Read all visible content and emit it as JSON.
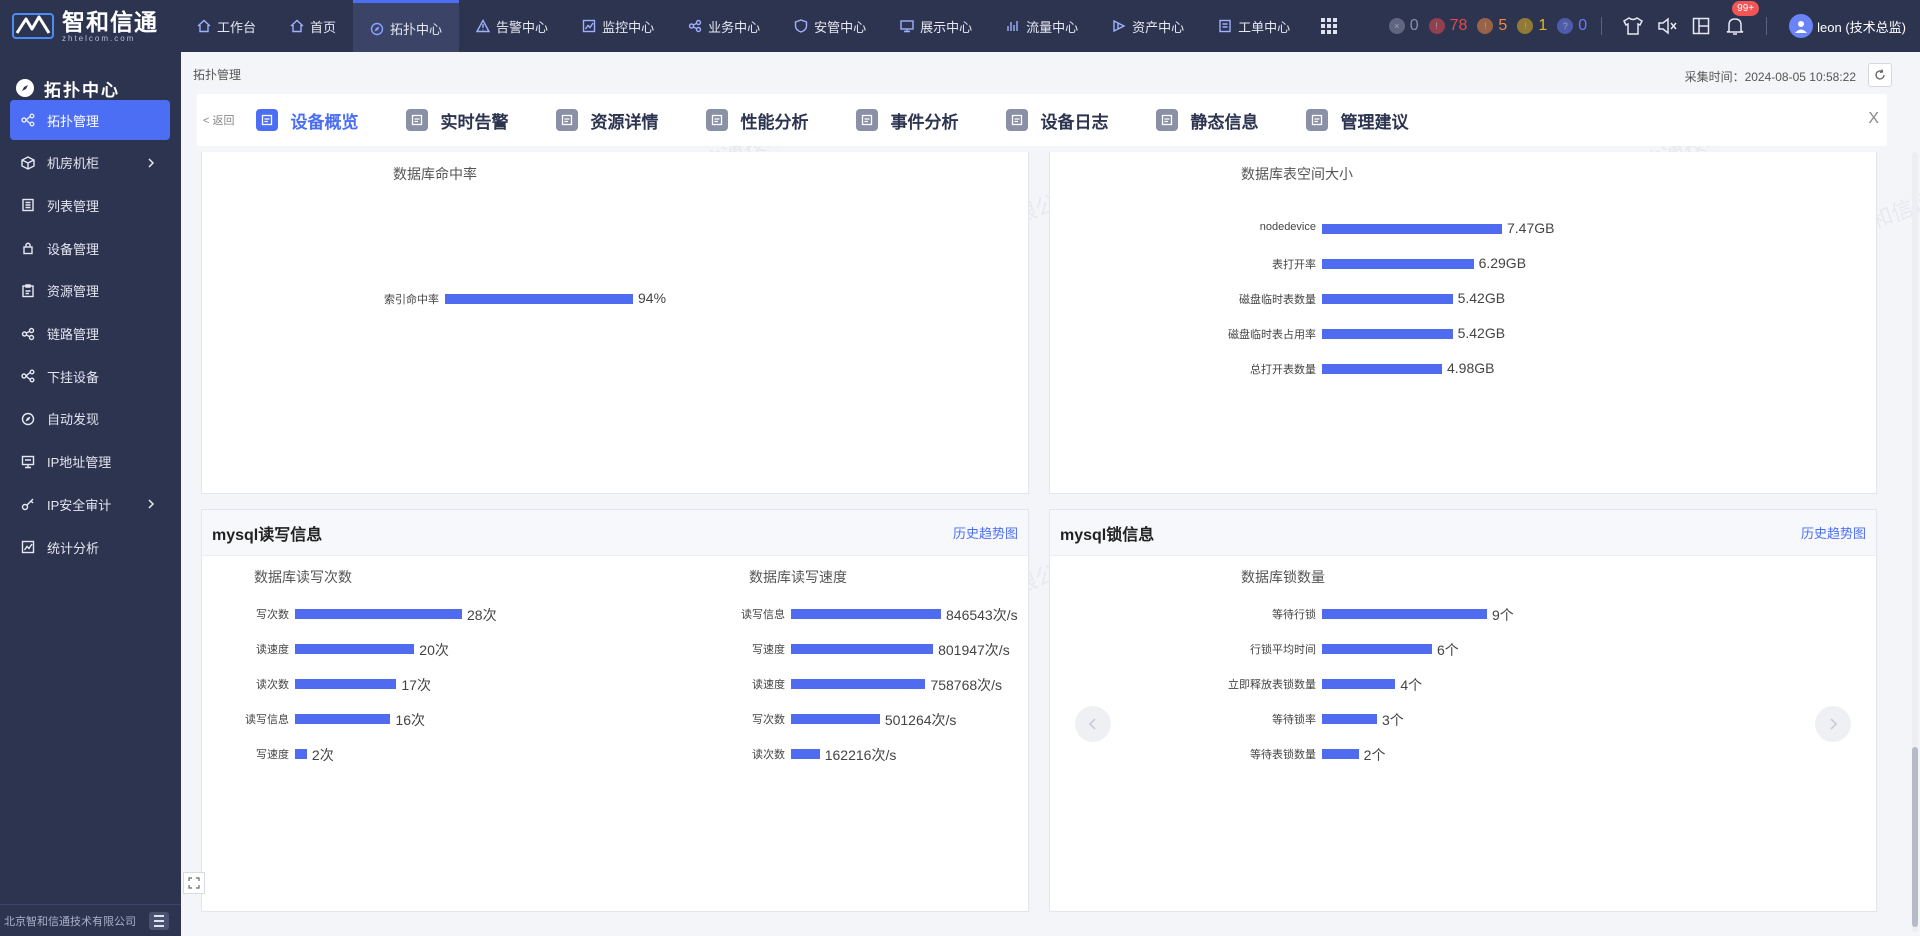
{
  "brand": {
    "name": "智和信通",
    "domain": "zhtelcom.com"
  },
  "nav": {
    "items": [
      {
        "label": "工作台",
        "icon": "home-icon"
      },
      {
        "label": "首页",
        "icon": "home-icon"
      },
      {
        "label": "拓扑中心",
        "icon": "compass-icon",
        "active": true
      },
      {
        "label": "告警中心",
        "icon": "warning-icon"
      },
      {
        "label": "监控中心",
        "icon": "chart-icon"
      },
      {
        "label": "业务中心",
        "icon": "link-icon"
      },
      {
        "label": "安管中心",
        "icon": "shield-icon"
      },
      {
        "label": "展示中心",
        "icon": "display-icon"
      },
      {
        "label": "流量中心",
        "icon": "traffic-icon"
      },
      {
        "label": "资产中心",
        "icon": "asset-icon"
      },
      {
        "label": "工单中心",
        "icon": "ticket-icon"
      }
    ]
  },
  "status": {
    "counts": [
      {
        "value": "0",
        "color": "#8a90a6"
      },
      {
        "value": "78",
        "color": "#e5484d"
      },
      {
        "value": "5",
        "color": "#f0883e"
      },
      {
        "value": "1",
        "color": "#e6b422"
      },
      {
        "value": "0",
        "color": "#6a7cf5"
      }
    ],
    "notifications": "99+",
    "user": "leon (技术总监)"
  },
  "sidebar": {
    "title": "拓扑中心",
    "items": [
      {
        "label": "拓扑管理",
        "icon": "topology-icon",
        "active": true
      },
      {
        "label": "机房机柜",
        "icon": "cube-icon",
        "expandable": true
      },
      {
        "label": "列表管理",
        "icon": "list-icon"
      },
      {
        "label": "设备管理",
        "icon": "device-icon"
      },
      {
        "label": "资源管理",
        "icon": "resource-icon"
      },
      {
        "label": "链路管理",
        "icon": "link-icon"
      },
      {
        "label": "下挂设备",
        "icon": "topology-icon"
      },
      {
        "label": "自动发现",
        "icon": "compass-icon"
      },
      {
        "label": "IP地址管理",
        "icon": "ip-icon"
      },
      {
        "label": "IP安全审计",
        "icon": "key-icon",
        "expandable": true
      },
      {
        "label": "统计分析",
        "icon": "chart-icon"
      }
    ],
    "footer": "北京智和信通技术有限公司"
  },
  "content": {
    "breadcrumb": "拓扑管理",
    "collect_time": "采集时间：2024-08-05 10:58:22",
    "back": "< 返回",
    "close": "X",
    "tabs": [
      {
        "label": "设备概览",
        "active": true
      },
      {
        "label": "实时告警"
      },
      {
        "label": "资源详情"
      },
      {
        "label": "性能分析"
      },
      {
        "label": "事件分析"
      },
      {
        "label": "设备日志"
      },
      {
        "label": "静态信息"
      },
      {
        "label": "管理建议"
      }
    ],
    "panels": {
      "rw": {
        "title": "mysql读写信息",
        "link": "历史趋势图"
      },
      "lock": {
        "title": "mysql锁信息",
        "link": "历史趋势图"
      }
    },
    "watermark": "北京智和信通技术有限公司"
  },
  "chart_data": [
    {
      "type": "bar",
      "orientation": "horizontal",
      "title": "数据库命中率",
      "categories": [
        "索引命中率"
      ],
      "values": [
        94
      ],
      "value_labels": [
        "94%"
      ],
      "max": 100
    },
    {
      "type": "bar",
      "orientation": "horizontal",
      "title": "数据库表空间大小",
      "categories": [
        "nodedevice",
        "表打开率",
        "磁盘临时表数量",
        "磁盘临时表占用率",
        "总打开表数量"
      ],
      "values": [
        7.47,
        6.29,
        5.42,
        5.42,
        4.98
      ],
      "value_labels": [
        "7.47GB",
        "6.29GB",
        "5.42GB",
        "5.42GB",
        "4.98GB"
      ],
      "max": 7.47
    },
    {
      "type": "bar",
      "orientation": "horizontal",
      "title": "数据库读写次数",
      "categories": [
        "写次数",
        "读速度",
        "读次数",
        "读写信息",
        "写速度"
      ],
      "values": [
        28,
        20,
        17,
        16,
        2
      ],
      "value_labels": [
        "28次",
        "20次",
        "17次",
        "16次",
        "2次"
      ],
      "max": 28
    },
    {
      "type": "bar",
      "orientation": "horizontal",
      "title": "数据库读写速度",
      "categories": [
        "读写信息",
        "写速度",
        "读速度",
        "写次数",
        "读次数"
      ],
      "values": [
        846543,
        801947,
        758768,
        501264,
        162216
      ],
      "value_labels": [
        "846543次/s",
        "801947次/s",
        "758768次/s",
        "501264次/s",
        "162216次/s"
      ],
      "max": 846543
    },
    {
      "type": "bar",
      "orientation": "horizontal",
      "title": "数据库锁数量",
      "categories": [
        "等待行锁",
        "行锁平均时间",
        "立即释放表锁数量",
        "等待锁率",
        "等待表锁数量"
      ],
      "values": [
        9,
        6,
        4,
        3,
        2
      ],
      "value_labels": [
        "9个",
        "6个",
        "4个",
        "3个",
        "2个"
      ],
      "max": 9
    }
  ]
}
